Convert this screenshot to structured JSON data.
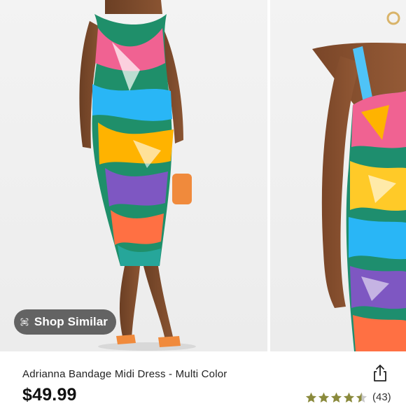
{
  "gallery": {
    "images": [
      {
        "icon": "model-photo-full-length"
      },
      {
        "icon": "model-photo-closeup"
      }
    ],
    "shop_similar": {
      "label": "Shop Similar",
      "icon": "camera-scan-icon"
    }
  },
  "product": {
    "title": "Adrianna Bandage Midi Dress - Multi Color",
    "price": "$49.99",
    "rating": {
      "value": 4.5,
      "max": 5,
      "count": "(43)"
    },
    "share_icon": "share-icon"
  },
  "colors": {
    "star": "#8a8a3c",
    "star_empty": "#c8c8c8",
    "pill_bg": "#3c3c3c"
  }
}
